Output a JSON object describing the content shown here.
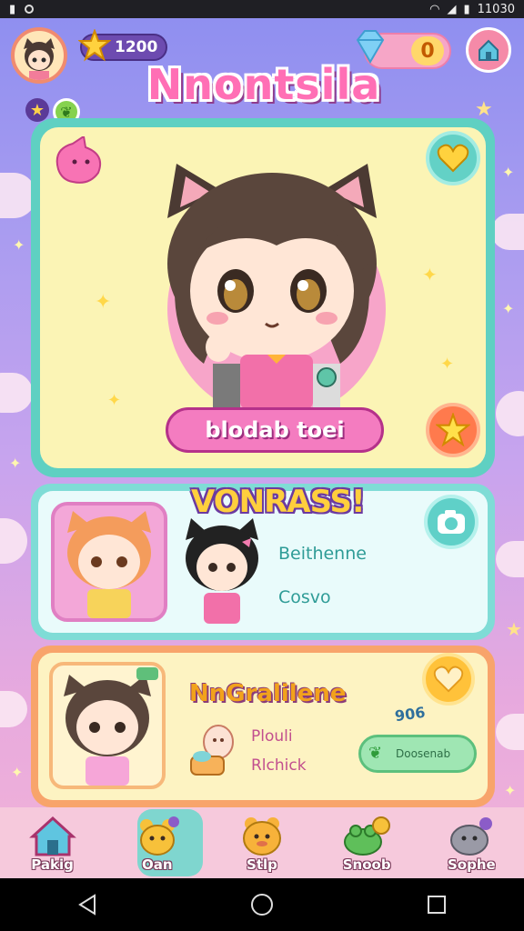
{
  "status_bar": {
    "time": "11030"
  },
  "header": {
    "coins": "1200",
    "gems": "0",
    "app_title": "Nnontsila"
  },
  "hero": {
    "character_name": "blodab toei"
  },
  "card2": {
    "title": "VONRASS!",
    "line1": "Beithenne",
    "line2": "Cosvo"
  },
  "card3": {
    "title": "NnGralilene",
    "line1": "Plouli",
    "line2": "Rlchick",
    "badge": "906",
    "button_label": "Doosenab"
  },
  "tabs": [
    {
      "label": "Pakig",
      "icon": "home-icon"
    },
    {
      "label": "Oan",
      "icon": "bear-icon"
    },
    {
      "label": "Stlp",
      "icon": "pet-icon"
    },
    {
      "label": "Snoob",
      "icon": "frog-icon"
    },
    {
      "label": "Sophe",
      "icon": "seal-icon"
    }
  ],
  "colors": {
    "accent_pink": "#f47cc0",
    "accent_teal": "#5fd0c2",
    "accent_orange": "#f8a46b"
  }
}
